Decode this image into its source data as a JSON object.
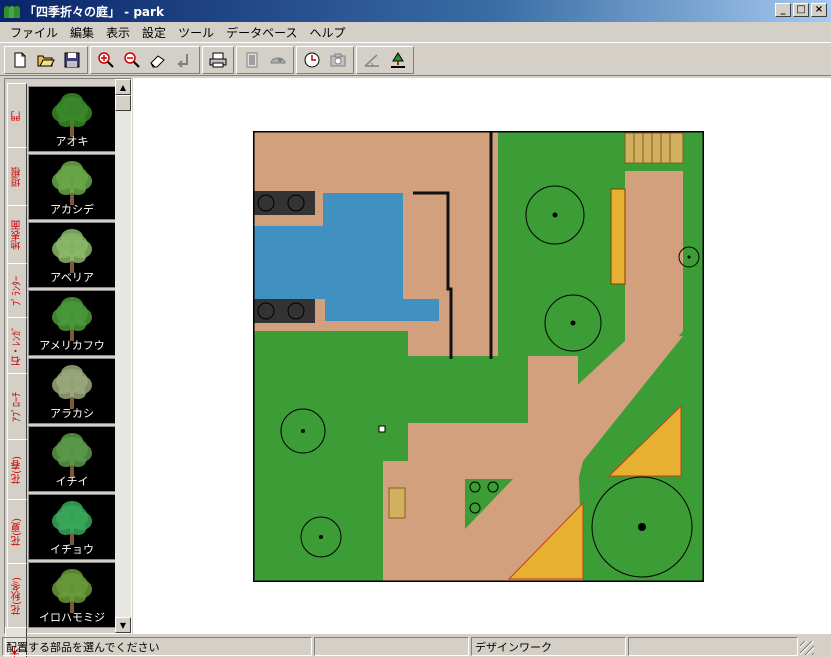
{
  "window": {
    "title": "「四季折々の庭」 - park",
    "controls": [
      "_",
      "□",
      "×"
    ]
  },
  "menu": [
    "ファイル",
    "編集",
    "表示",
    "設定",
    "ツール",
    "データベース",
    "ヘルプ"
  ],
  "toolbar": {
    "groups": [
      [
        "new-file-icon",
        "open-folder-icon",
        "save-disk-icon"
      ],
      [
        "zoom-in-icon",
        "zoom-out-icon",
        "eraser-icon",
        "undo-icon"
      ],
      [
        "print-icon"
      ],
      [
        "page-icon",
        "camera-view-icon"
      ],
      [
        "clock-icon",
        "snapshot-icon"
      ],
      [
        "terrain-icon",
        "tree-person-icon"
      ]
    ]
  },
  "palette": {
    "tabs": [
      "門",
      "垣根",
      "地表面",
      "ﾌﾟﾗﾝﾀｰ",
      "石・ﾚﾝｶﾞ",
      "ｱﾌﾟﾛｰﾁ",
      "花(春)",
      "花(夏)",
      "花(秋冬)",
      "樹木"
    ],
    "active_tab": "樹木",
    "items": [
      "アオキ",
      "アカシデ",
      "アベリア",
      "アメリカフウ",
      "アラカシ",
      "イチイ",
      "イチョウ",
      "イロハモミジ"
    ]
  },
  "status": {
    "message": "配置する部品を選んでください",
    "mode": "デザインワーク"
  },
  "colors": {
    "title_gradient_start": "#0a246a",
    "lawn": "#3c9d36",
    "path": "#d2a07d",
    "pond": "#4090c0",
    "flowers": "#e8b030",
    "tab_text": "#cc0000"
  }
}
